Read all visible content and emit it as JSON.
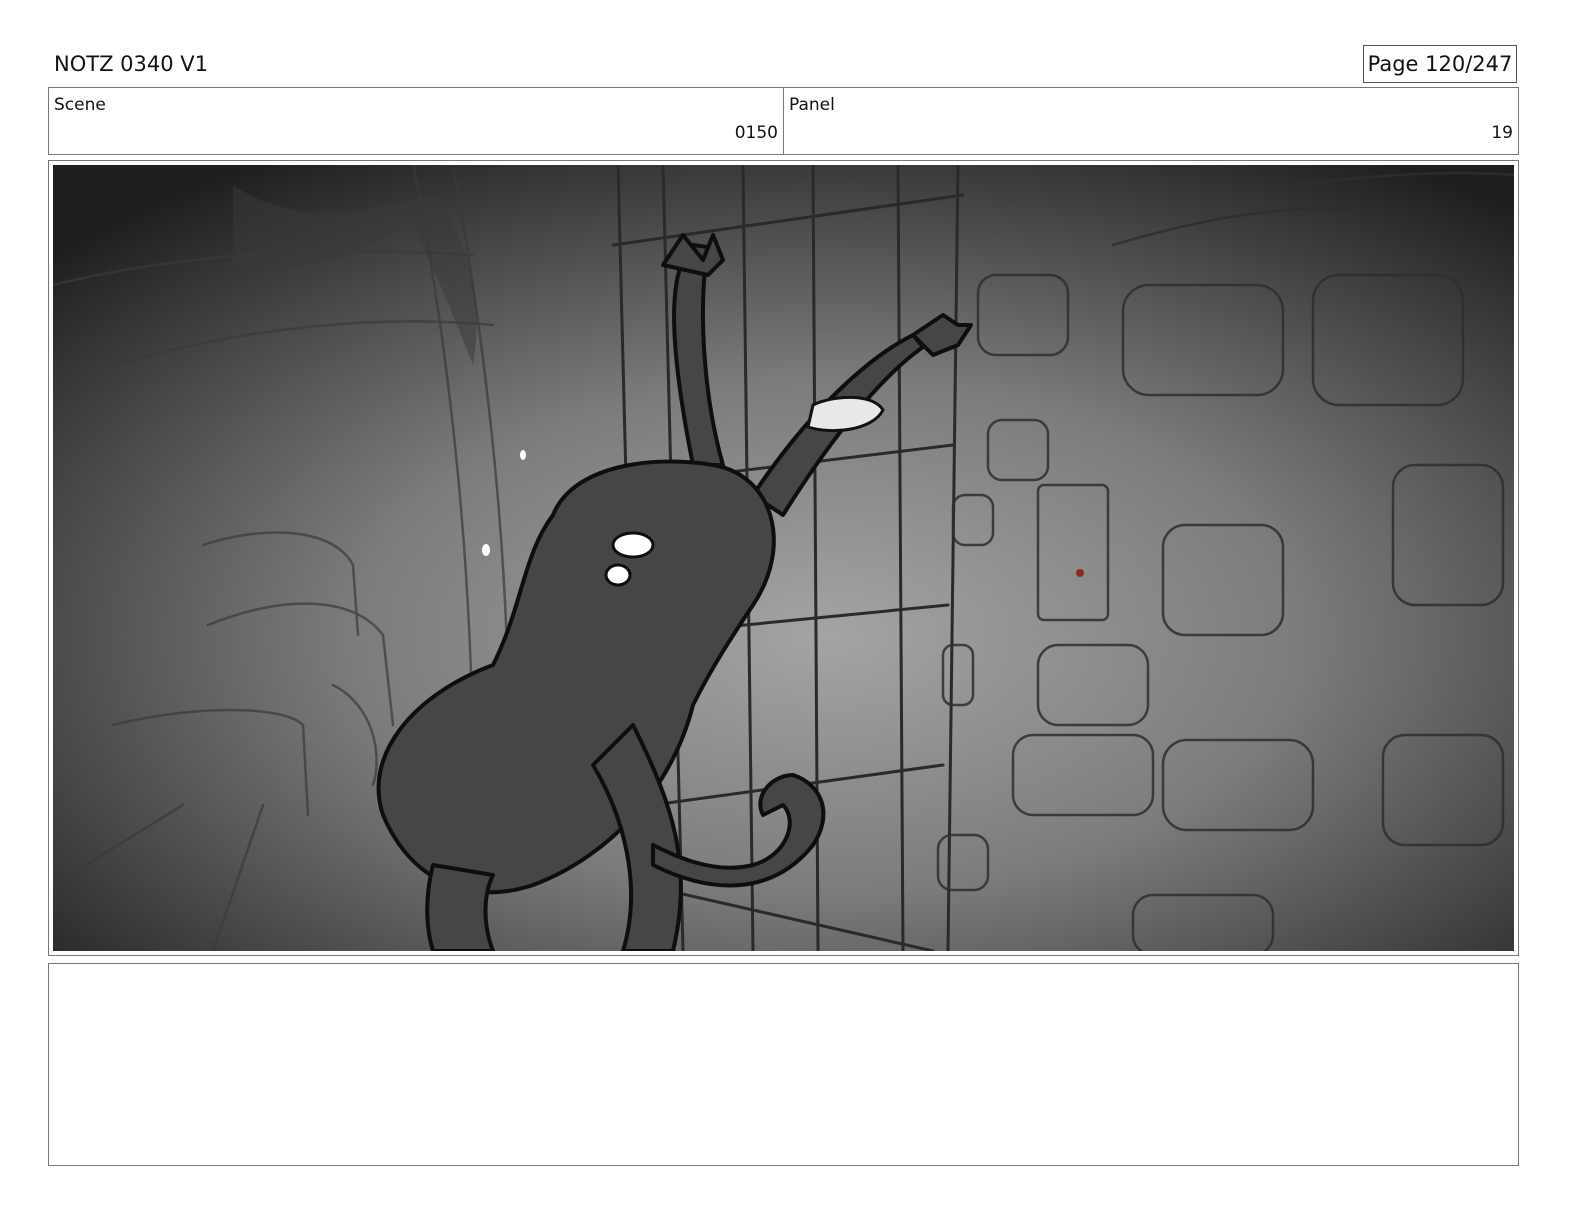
{
  "header": {
    "title": "NOTZ 0340 V1",
    "page": "Page 120/247"
  },
  "info": {
    "scene_label": "Scene",
    "scene_value": "0150",
    "panel_label": "Panel",
    "panel_value": "19"
  },
  "notes": {
    "text": ""
  }
}
